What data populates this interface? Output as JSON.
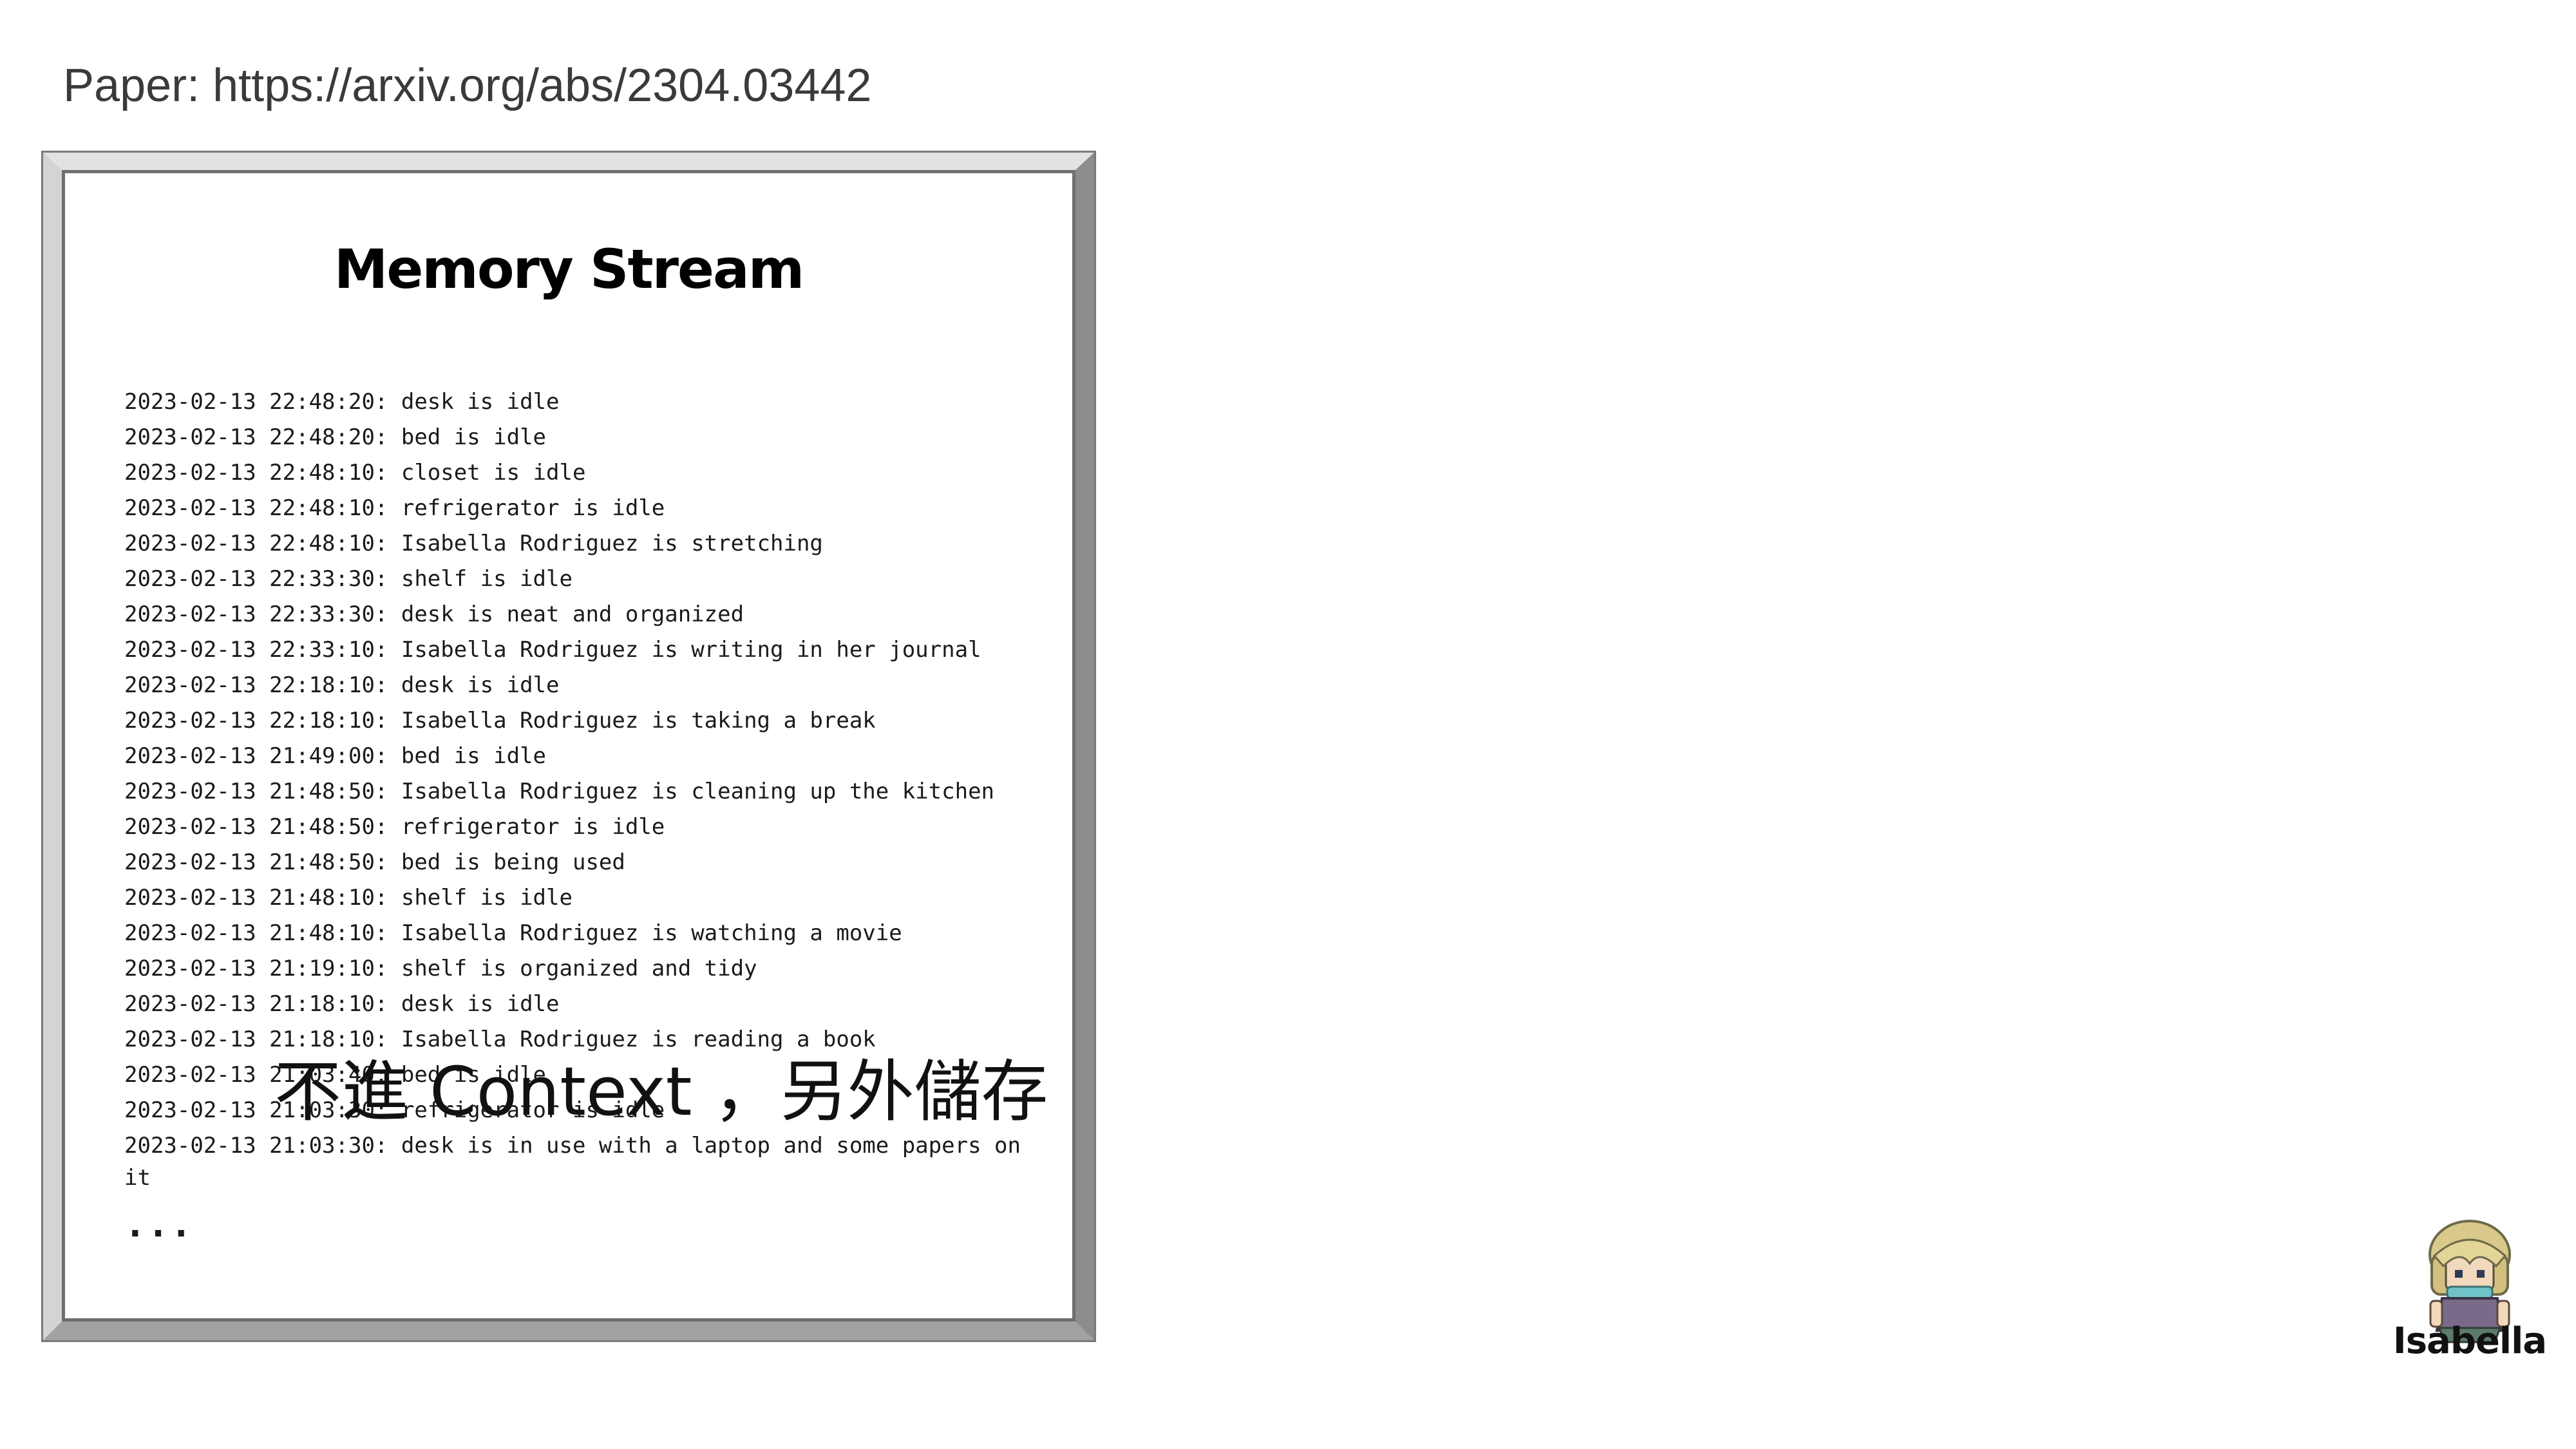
{
  "source": {
    "text": "Paper: https://arxiv.org/abs/2304.03442"
  },
  "memory_stream": {
    "title": "Memory Stream",
    "entries": [
      "2023-02-13 22:48:20: desk is idle",
      "2023-02-13 22:48:20: bed is idle",
      "2023-02-13 22:48:10: closet is idle",
      "2023-02-13 22:48:10: refrigerator is idle",
      "2023-02-13 22:48:10: Isabella Rodriguez is stretching",
      "2023-02-13 22:33:30: shelf is idle",
      "2023-02-13 22:33:30: desk is neat and organized",
      "2023-02-13 22:33:10: Isabella Rodriguez is writing in her journal",
      "2023-02-13 22:18:10: desk is idle",
      "2023-02-13 22:18:10: Isabella Rodriguez is taking a break",
      "2023-02-13 21:49:00: bed is idle",
      "2023-02-13 21:48:50: Isabella Rodriguez is cleaning up the kitchen",
      "2023-02-13 21:48:50: refrigerator is idle",
      "2023-02-13 21:48:50: bed is being used",
      "2023-02-13 21:48:10: shelf is idle",
      "2023-02-13 21:48:10: Isabella Rodriguez is watching a movie",
      "2023-02-13 21:19:10: shelf is organized and tidy",
      "2023-02-13 21:18:10: desk is idle",
      "2023-02-13 21:18:10: Isabella Rodriguez is reading a book",
      "2023-02-13 21:03:40: bed is idle",
      "2023-02-13 21:03:30: refrigerator is idle",
      "2023-02-13 21:03:30: desk is in use with a laptop and some papers on it"
    ],
    "ellipsis": "...",
    "note": "不進 Context ，另外儲存"
  },
  "character": {
    "name": "Isabella",
    "icon": "character-sprite-icon"
  }
}
